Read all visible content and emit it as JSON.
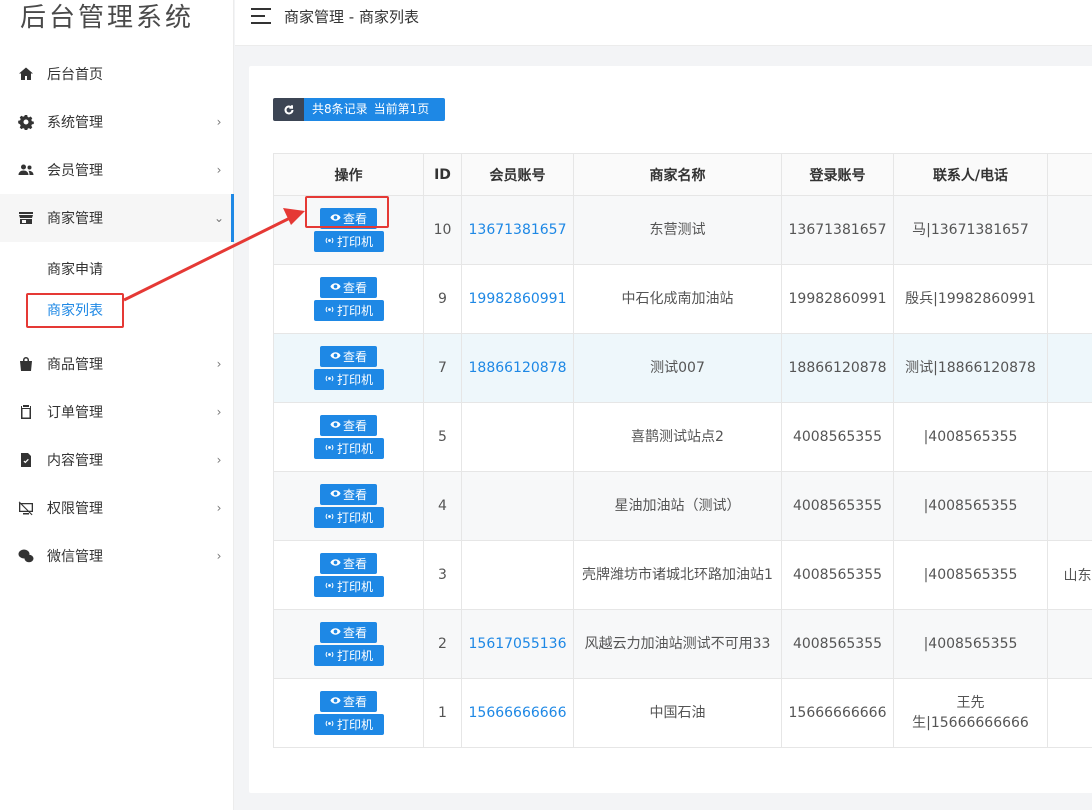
{
  "app": {
    "title": "后台管理系统"
  },
  "header": {
    "breadcrumb": "商家管理 - 商家列表"
  },
  "sidebar": {
    "items": [
      {
        "label": "后台首页",
        "icon": "home-icon",
        "has_chevron": false
      },
      {
        "label": "系统管理",
        "icon": "gear-icon",
        "has_chevron": true
      },
      {
        "label": "会员管理",
        "icon": "users-icon",
        "has_chevron": true
      },
      {
        "label": "商家管理",
        "icon": "store-icon",
        "has_chevron": true,
        "expanded": true
      },
      {
        "label": "商品管理",
        "icon": "bag-icon",
        "has_chevron": true
      },
      {
        "label": "订单管理",
        "icon": "clipboard-icon",
        "has_chevron": true
      },
      {
        "label": "内容管理",
        "icon": "document-check-icon",
        "has_chevron": true
      },
      {
        "label": "权限管理",
        "icon": "monitor-off-icon",
        "has_chevron": true
      },
      {
        "label": "微信管理",
        "icon": "wechat-icon",
        "has_chevron": true
      }
    ],
    "submenu": [
      {
        "label": "商家申请",
        "active": false
      },
      {
        "label": "商家列表",
        "active": true
      }
    ]
  },
  "toolbar": {
    "total_text": "共8条记录",
    "page_text": "当前第1页"
  },
  "table": {
    "columns": [
      "操作",
      "ID",
      "会员账号",
      "商家名称",
      "登录账号",
      "联系人/电话",
      ""
    ],
    "view_label": "查看",
    "print_label": "打印机",
    "rows": [
      {
        "id": "10",
        "member": "13671381657",
        "name": "东营测试",
        "login": "13671381657",
        "contact": "马|13671381657",
        "extra": ""
      },
      {
        "id": "9",
        "member": "19982860991",
        "name": "中石化成南加油站",
        "login": "19982860991",
        "contact": "殷兵|19982860991",
        "extra": ""
      },
      {
        "id": "7",
        "member": "18866120878",
        "name": "测试007",
        "login": "18866120878",
        "contact": "测试|18866120878",
        "extra": ""
      },
      {
        "id": "5",
        "member": "",
        "name": "喜鹊测试站点2",
        "login": "4008565355",
        "contact": "|4008565355",
        "extra": ""
      },
      {
        "id": "4",
        "member": "",
        "name": "星油加油站（测试）",
        "login": "4008565355",
        "contact": "|4008565355",
        "extra": ""
      },
      {
        "id": "3",
        "member": "",
        "name": "壳牌潍坊市诸城北环路加油站1",
        "login": "4008565355",
        "contact": "|4008565355",
        "extra": "山东"
      },
      {
        "id": "2",
        "member": "15617055136",
        "name": "风越云力加油站测试不可用33",
        "login": "4008565355",
        "contact": "|4008565355",
        "extra": ""
      },
      {
        "id": "1",
        "member": "15666666666",
        "name": "中国石油",
        "login": "15666666666",
        "contact": "王先生|15666666666",
        "extra": ""
      }
    ]
  },
  "colors": {
    "accent": "#1e88e5",
    "annotation": "#e53935",
    "dark_button": "#3c4554"
  }
}
